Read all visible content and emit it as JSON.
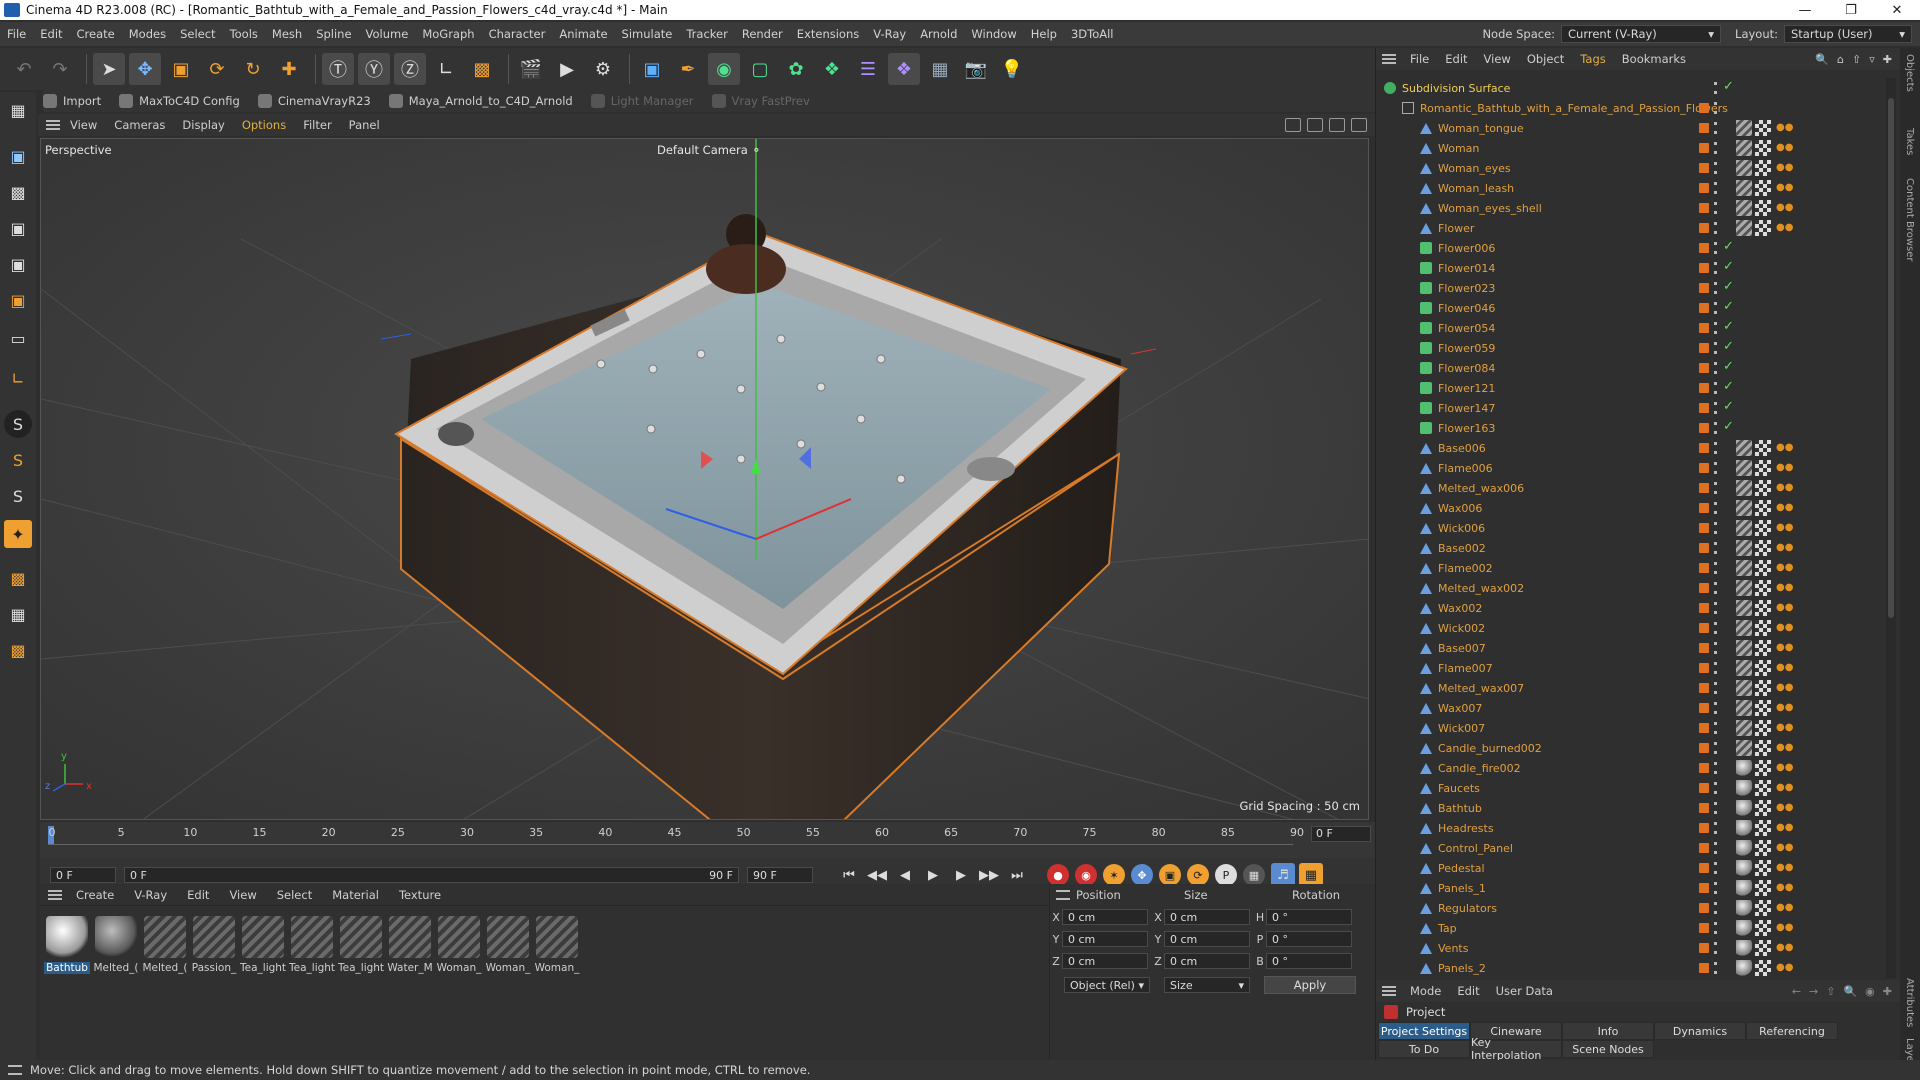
{
  "window": {
    "title": "Cinema 4D R23.008 (RC) - [Romantic_Bathtub_with_a_Female_and_Passion_Flowers_c4d_vray.c4d *] - Main"
  },
  "menubar": {
    "items": [
      "File",
      "Edit",
      "Create",
      "Modes",
      "Select",
      "Tools",
      "Mesh",
      "Spline",
      "Volume",
      "MoGraph",
      "Character",
      "Animate",
      "Simulate",
      "Tracker",
      "Render",
      "Extensions",
      "V-Ray",
      "Arnold",
      "Window",
      "Help",
      "3DToAll"
    ],
    "node_space_label": "Node Space:",
    "node_space_value": "Current (V-Ray)",
    "layout_label": "Layout:",
    "layout_value": "Startup (User)"
  },
  "plugins": [
    {
      "label": "Import",
      "enabled": true
    },
    {
      "label": "MaxToC4D Config",
      "enabled": true
    },
    {
      "label": "CinemaVrayR23",
      "enabled": true
    },
    {
      "label": "Maya_Arnold_to_C4D_Arnold",
      "enabled": true
    },
    {
      "label": "Light Manager",
      "enabled": false
    },
    {
      "label": "Vray FastPrev",
      "enabled": false
    }
  ],
  "viewport": {
    "menu": [
      "View",
      "Cameras",
      "Display",
      "Options",
      "Filter",
      "Panel"
    ],
    "mode": "Perspective",
    "camera": "Default Camera",
    "grid_spacing": "Grid Spacing : 50 cm"
  },
  "timeline": {
    "ticks": [
      "0",
      "5",
      "10",
      "15",
      "20",
      "25",
      "30",
      "35",
      "40",
      "45",
      "50",
      "55",
      "60",
      "65",
      "70",
      "75",
      "80",
      "85",
      "90"
    ],
    "current_frame": "0 F",
    "start_field": "0 F",
    "preview_field": "0 F",
    "end_field": "90 F",
    "end_field2": "90 F"
  },
  "material_manager": {
    "menu": [
      "Create",
      "V-Ray",
      "Edit",
      "View",
      "Select",
      "Material",
      "Texture"
    ],
    "materials": [
      {
        "name": "Bathtub",
        "style": "sphere-white",
        "selected": true
      },
      {
        "name": "Melted_(",
        "style": "sphere-grey",
        "selected": false
      },
      {
        "name": "Melted_(",
        "style": "stripes",
        "selected": false
      },
      {
        "name": "Passion_",
        "style": "stripes",
        "selected": false
      },
      {
        "name": "Tea_light",
        "style": "stripes",
        "selected": false
      },
      {
        "name": "Tea_light",
        "style": "stripes",
        "selected": false
      },
      {
        "name": "Tea_light",
        "style": "stripes",
        "selected": false
      },
      {
        "name": "Water_M",
        "style": "stripes",
        "selected": false
      },
      {
        "name": "Woman_",
        "style": "stripes",
        "selected": false
      },
      {
        "name": "Woman_",
        "style": "stripes",
        "selected": false
      },
      {
        "name": "Woman_",
        "style": "stripes",
        "selected": false
      }
    ]
  },
  "coordinates": {
    "headers": [
      "Position",
      "Size",
      "Rotation"
    ],
    "rows": [
      {
        "axis": "X",
        "pos": "0 cm",
        "size_axis": "X",
        "size": "0 cm",
        "rot_axis": "H",
        "rot": "0 °"
      },
      {
        "axis": "Y",
        "pos": "0 cm",
        "size_axis": "Y",
        "size": "0 cm",
        "rot_axis": "P",
        "rot": "0 °"
      },
      {
        "axis": "Z",
        "pos": "0 cm",
        "size_axis": "Z",
        "size": "0 cm",
        "rot_axis": "B",
        "rot": "0 °"
      }
    ],
    "mode": "Object (Rel)",
    "size_mode": "Size",
    "apply": "Apply"
  },
  "object_manager": {
    "menu": [
      "File",
      "Edit",
      "View",
      "Object",
      "Tags",
      "Bookmarks"
    ],
    "objects": [
      {
        "name": "Subdivision Surface",
        "level": 0,
        "type": "subdiv",
        "check": true,
        "tags": "none",
        "top": true
      },
      {
        "name": "Romantic_Bathtub_with_a_Female_and_Passion_Flowers",
        "level": 1,
        "type": "null",
        "check": false,
        "tags": "none"
      },
      {
        "name": "Woman_tongue",
        "level": 2,
        "type": "poly",
        "check": false,
        "tags": "stripe"
      },
      {
        "name": "Woman",
        "level": 2,
        "type": "poly",
        "check": false,
        "tags": "stripe"
      },
      {
        "name": "Woman_eyes",
        "level": 2,
        "type": "poly",
        "check": false,
        "tags": "stripe"
      },
      {
        "name": "Woman_leash",
        "level": 2,
        "type": "poly",
        "check": false,
        "tags": "stripe"
      },
      {
        "name": "Woman_eyes_shell",
        "level": 2,
        "type": "poly",
        "check": false,
        "tags": "stripe"
      },
      {
        "name": "Flower",
        "level": 2,
        "type": "poly",
        "check": false,
        "tags": "stripe"
      },
      {
        "name": "Flower006",
        "level": 2,
        "type": "flower",
        "check": true,
        "tags": "none"
      },
      {
        "name": "Flower014",
        "level": 2,
        "type": "flower",
        "check": true,
        "tags": "none"
      },
      {
        "name": "Flower023",
        "level": 2,
        "type": "flower",
        "check": true,
        "tags": "none"
      },
      {
        "name": "Flower046",
        "level": 2,
        "type": "flower",
        "check": true,
        "tags": "none"
      },
      {
        "name": "Flower054",
        "level": 2,
        "type": "flower",
        "check": true,
        "tags": "none"
      },
      {
        "name": "Flower059",
        "level": 2,
        "type": "flower",
        "check": true,
        "tags": "none"
      },
      {
        "name": "Flower084",
        "level": 2,
        "type": "flower",
        "check": true,
        "tags": "none"
      },
      {
        "name": "Flower121",
        "level": 2,
        "type": "flower",
        "check": true,
        "tags": "none"
      },
      {
        "name": "Flower147",
        "level": 2,
        "type": "flower",
        "check": true,
        "tags": "none"
      },
      {
        "name": "Flower163",
        "level": 2,
        "type": "flower",
        "check": true,
        "tags": "none"
      },
      {
        "name": "Base006",
        "level": 2,
        "type": "poly",
        "check": false,
        "tags": "stripe"
      },
      {
        "name": "Flame006",
        "level": 2,
        "type": "poly",
        "check": false,
        "tags": "stripe"
      },
      {
        "name": "Melted_wax006",
        "level": 2,
        "type": "poly",
        "check": false,
        "tags": "stripe"
      },
      {
        "name": "Wax006",
        "level": 2,
        "type": "poly",
        "check": false,
        "tags": "stripe"
      },
      {
        "name": "Wick006",
        "level": 2,
        "type": "poly",
        "check": false,
        "tags": "stripe"
      },
      {
        "name": "Base002",
        "level": 2,
        "type": "poly",
        "check": false,
        "tags": "stripe"
      },
      {
        "name": "Flame002",
        "level": 2,
        "type": "poly",
        "check": false,
        "tags": "stripe"
      },
      {
        "name": "Melted_wax002",
        "level": 2,
        "type": "poly",
        "check": false,
        "tags": "stripe"
      },
      {
        "name": "Wax002",
        "level": 2,
        "type": "poly",
        "check": false,
        "tags": "stripe"
      },
      {
        "name": "Wick002",
        "level": 2,
        "type": "poly",
        "check": false,
        "tags": "stripe"
      },
      {
        "name": "Base007",
        "level": 2,
        "type": "poly",
        "check": false,
        "tags": "stripe"
      },
      {
        "name": "Flame007",
        "level": 2,
        "type": "poly",
        "check": false,
        "tags": "stripe"
      },
      {
        "name": "Melted_wax007",
        "level": 2,
        "type": "poly",
        "check": false,
        "tags": "stripe"
      },
      {
        "name": "Wax007",
        "level": 2,
        "type": "poly",
        "check": false,
        "tags": "stripe"
      },
      {
        "name": "Wick007",
        "level": 2,
        "type": "poly",
        "check": false,
        "tags": "stripe"
      },
      {
        "name": "Candle_burned002",
        "level": 2,
        "type": "poly",
        "check": false,
        "tags": "stripe"
      },
      {
        "name": "Candle_fire002",
        "level": 2,
        "type": "poly",
        "check": false,
        "tags": "sphere"
      },
      {
        "name": "Faucets",
        "level": 2,
        "type": "poly",
        "check": false,
        "tags": "sphere"
      },
      {
        "name": "Bathtub",
        "level": 2,
        "type": "poly",
        "check": false,
        "tags": "sphere"
      },
      {
        "name": "Headrests",
        "level": 2,
        "type": "poly",
        "check": false,
        "tags": "sphere"
      },
      {
        "name": "Control_Panel",
        "level": 2,
        "type": "poly",
        "check": false,
        "tags": "sphere"
      },
      {
        "name": "Pedestal",
        "level": 2,
        "type": "poly",
        "check": false,
        "tags": "sphere"
      },
      {
        "name": "Panels_1",
        "level": 2,
        "type": "poly",
        "check": false,
        "tags": "sphere"
      },
      {
        "name": "Regulators",
        "level": 2,
        "type": "poly",
        "check": false,
        "tags": "sphere"
      },
      {
        "name": "Tap",
        "level": 2,
        "type": "poly",
        "check": false,
        "tags": "sphere"
      },
      {
        "name": "Vents",
        "level": 2,
        "type": "poly",
        "check": false,
        "tags": "sphere"
      },
      {
        "name": "Panels_2",
        "level": 2,
        "type": "poly",
        "check": false,
        "tags": "sphere"
      }
    ]
  },
  "attribute_manager": {
    "menu": [
      "Mode",
      "Edit",
      "User Data"
    ],
    "object": "Project",
    "tabs": [
      {
        "label": "Project Settings",
        "selected": true
      },
      {
        "label": "Cineware",
        "selected": false
      },
      {
        "label": "Info",
        "selected": false
      },
      {
        "label": "Dynamics",
        "selected": false
      },
      {
        "label": "Referencing",
        "selected": false
      },
      {
        "label": "To Do",
        "selected": false
      },
      {
        "label": "Key Interpolation",
        "selected": false
      },
      {
        "label": "Scene Nodes",
        "selected": false
      }
    ]
  },
  "right_strip": [
    "Objects",
    "Takes",
    "Content Browser",
    "Attributes",
    "Layers"
  ],
  "status": "Move: Click and drag to move elements. Hold down SHIFT to quantize movement / add to the selection in point mode, CTRL to remove.",
  "colors": {
    "accent_orange": "#e07020",
    "object_name": "#e0a040",
    "selection_blue": "#2b5c8a",
    "axis_green": "#40c040",
    "axis_red": "#e03030",
    "axis_blue": "#3060e0"
  }
}
